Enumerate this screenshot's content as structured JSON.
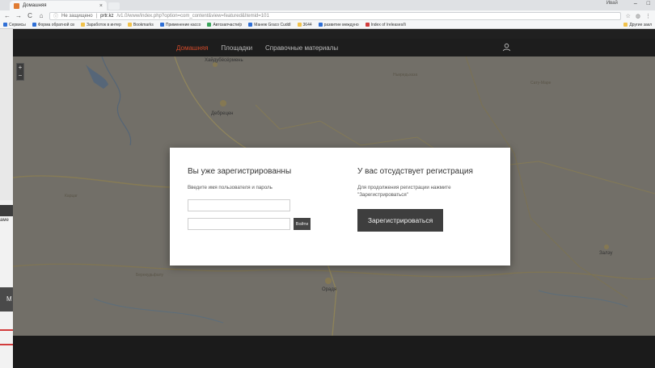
{
  "browser": {
    "tab_title": "Домашняя",
    "tab_close": "×",
    "user_name": "Ивай",
    "window_controls": [
      "–",
      "□"
    ],
    "security_label": "Не защищено",
    "url_host": "prtr.kz",
    "url_path": "/v1.0/www/index.php?option=com_content&view=featured&Itemid=101",
    "nav": {
      "back": "←",
      "forward": "→",
      "reload": "C",
      "home": "⌂"
    },
    "bookmarks": [
      {
        "label": "Сервисы",
        "color": "blue"
      },
      {
        "label": "Форма обратной св",
        "color": "blue"
      },
      {
        "label": "Заработок в интер",
        "color": "yellow"
      },
      {
        "label": "Bookmarks",
        "color": "yellow"
      },
      {
        "label": "Применение кассо",
        "color": "blue"
      },
      {
        "label": "Автозапчасти/р",
        "color": "green"
      },
      {
        "label": "Манеж Graco Cuddl",
        "color": "blue"
      },
      {
        "label": "3644",
        "color": "yellow"
      },
      {
        "label": "развитие междуно",
        "color": "blue"
      },
      {
        "label": "Index of /releases/li",
        "color": "red"
      }
    ],
    "bookmarks_right": "Другие закл"
  },
  "site": {
    "nav_links": [
      "Домашняя",
      "Площадки",
      "Справочные материалы"
    ],
    "active_link": "Домашняя",
    "accent_color": "#d24a2a"
  },
  "map": {
    "zoom_in": "+",
    "zoom_out": "−",
    "labels": [
      "Хайдубёсёрмень",
      "Дебрецен",
      "Орадя",
      "Залэу",
      "Карцаг",
      "Берекудьфалу",
      "Сату-Маре",
      "Ньиредьхаза"
    ]
  },
  "login": {
    "title": "Вы уже зарегистрированны",
    "instruction": "Введите имя пользователя и пароль",
    "username_value": "",
    "password_value": "",
    "login_button": "Войти"
  },
  "register": {
    "title": "У вас отсудствует регистрация",
    "instruction": "Для продолжения регистрации нажмите \"Зарегистрироваться\"",
    "register_button": "Зарегистрироваться"
  },
  "ghost_window": {
    "fragment_text": "аме",
    "button_letter": "М"
  }
}
